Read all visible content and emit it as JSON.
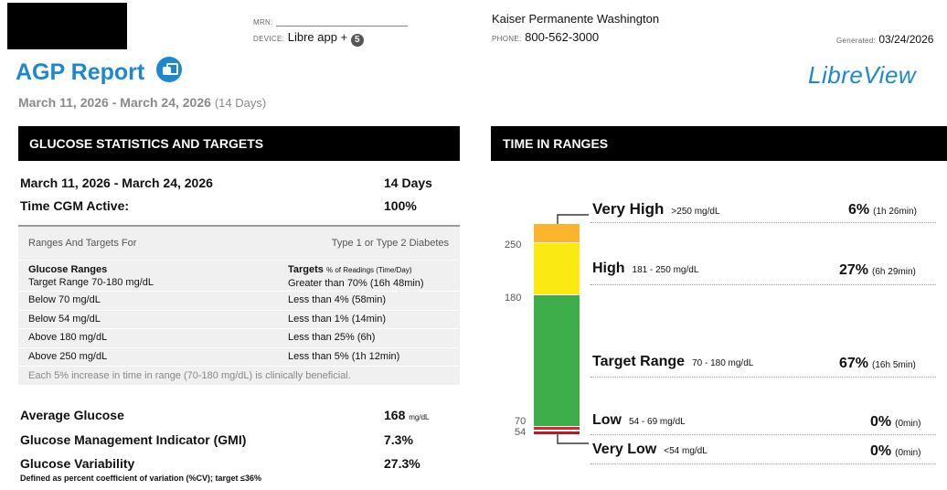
{
  "header": {
    "mrn_label": "MRN:",
    "device_label": "DEVICE:",
    "device_value": "Libre app +",
    "device_badge": "5",
    "clinic_name": "Kaiser Permanente Washington",
    "phone_label": "PHONE:",
    "phone_value": "800-562-3000",
    "generated_label": "Generated:",
    "generated_value": "03/24/2026",
    "report_title": "AGP Report",
    "date_range": "March 11, 2026 - March 24, 2026",
    "days_note": "(14 Days)",
    "logo_text": "LibreView"
  },
  "glucose_stats": {
    "heading": "GLUCOSE STATISTICS AND TARGETS",
    "period_label": "March 11, 2026 - March 24, 2026",
    "period_value": "14 Days",
    "cgm_active_label": "Time CGM Active:",
    "cgm_active_value": "100%",
    "ranges_for_label": "Ranges And Targets For",
    "ranges_for_value": "Type 1 or Type 2 Diabetes",
    "col1_header": "Glucose Ranges",
    "col1_sub": "Target Range 70-180 mg/dL",
    "col2_header": "Targets",
    "col2_header_small": "% of Readings (Time/Day)",
    "col2_sub": "Greater than 70% (16h 48min)",
    "rows": [
      {
        "range": "Below 70 mg/dL",
        "target": "Less than 4% (58min)"
      },
      {
        "range": "Below 54 mg/dL",
        "target": "Less than 1% (14min)"
      },
      {
        "range": "Above 180 mg/dL",
        "target": "Less than 25% (6h)"
      },
      {
        "range": "Above 250 mg/dL",
        "target": "Less than 5% (1h 12min)"
      }
    ],
    "benefit_note": "Each 5% increase in time in range (70-180 mg/dL) is clinically beneficial.",
    "avg_glucose_label": "Average Glucose",
    "avg_glucose_value": "168",
    "avg_glucose_unit": "mg/dL",
    "gmi_label": "Glucose Management Indicator (GMI)",
    "gmi_value": "7.3%",
    "variability_label": "Glucose Variability",
    "variability_value": "27.3%",
    "variability_note": "Defined as percent coefficient of variation (%CV); target ≤36%"
  },
  "time_in_ranges": {
    "heading": "TIME IN RANGES",
    "ticks": [
      "250",
      "180",
      "70",
      "54"
    ],
    "ranges": [
      {
        "name": "Very High",
        "range": ">250 mg/dL",
        "percent": "6%",
        "time": "(1h 26min)",
        "color": "#fbb42b"
      },
      {
        "name": "High",
        "range": "181 - 250 mg/dL",
        "percent": "27%",
        "time": "(6h 29min)",
        "color": "#fbe913"
      },
      {
        "name": "Target Range",
        "range": "70 - 180 mg/dL",
        "percent": "67%",
        "time": "(16h 5min)",
        "color": "#3dae49"
      },
      {
        "name": "Low",
        "range": "54 - 69 mg/dL",
        "percent": "0%",
        "time": "(0min)",
        "color": "#e3222c"
      },
      {
        "name": "Very Low",
        "range": "<54 mg/dL",
        "percent": "0%",
        "time": "(0min)",
        "color": "#b01e2a"
      }
    ]
  }
}
